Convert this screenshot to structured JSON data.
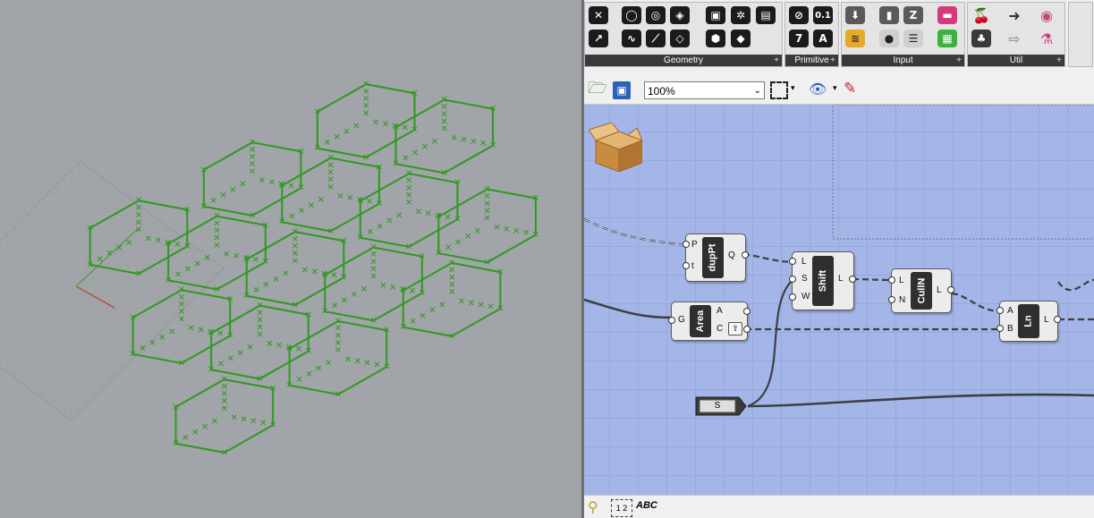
{
  "ribbon": {
    "groups": [
      {
        "id": "geometry",
        "label": "Geometry"
      },
      {
        "id": "primitive",
        "label": "Primitive"
      },
      {
        "id": "input",
        "label": "Input"
      },
      {
        "id": "util",
        "label": "Util"
      }
    ],
    "primitive_buttons": [
      "0.1",
      "7",
      "A"
    ]
  },
  "toolbar": {
    "zoom_value": "100%",
    "zoom_arrow": "⌄"
  },
  "nodes": {
    "duppt": {
      "name": "dupPt",
      "inputs": [
        "P",
        "t"
      ],
      "outputs": [
        "Q"
      ]
    },
    "shift": {
      "name": "Shift",
      "inputs": [
        "L",
        "S",
        "W"
      ],
      "outputs": [
        "L"
      ]
    },
    "culln": {
      "name": "CullN",
      "inputs": [
        "L",
        "N"
      ],
      "outputs": [
        "L"
      ]
    },
    "area": {
      "name": "Area",
      "inputs": [
        "G"
      ],
      "outputs": [
        "A",
        "C"
      ]
    },
    "ln": {
      "name": "Ln",
      "inputs": [
        "A",
        "B"
      ],
      "outputs": [
        "L"
      ]
    },
    "panel": {
      "label": "S"
    }
  },
  "bottombar": {
    "items": [
      "1 2",
      "ABC"
    ]
  },
  "colors": {
    "viewport_bg": "#a1a4a8",
    "geometry_green": "#2e9a1e",
    "canvas_bg": "#a4b6e8",
    "wire": "#3d3f44"
  }
}
